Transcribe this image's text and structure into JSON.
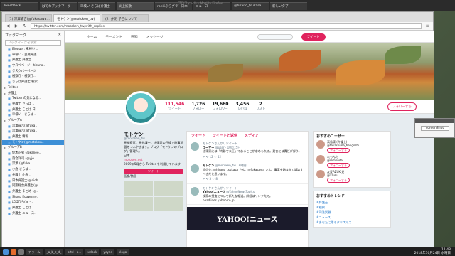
{
  "os_tabs": [
    "TweetDeck",
    "はてなブックマーク",
    "車検い さらば弁護士",
    "炎上拡散",
    "rankiぷらグラ - 日本",
    "ニュース",
    "@hirano_tsukasa",
    "新しいタブ"
  ],
  "window_title": "プロフィール - Mozilla Firefox",
  "browser_tabs": [
    "(1) 深澤諭吉(@fukasawa…",
    "モトケン(@motoken_tw)",
    "(2) 弁明 予告について"
  ],
  "url": "https://twitter.com/motoken_tw/with_replies",
  "sidebar": {
    "title": "ブックマーク",
    "search_placeholder": "ブックマークを検索",
    "items": [
      {
        "label": "Blogger: 車検い ..",
        "folder": false,
        "selected": false
      },
      {
        "label": "車検い - 良識弁護..",
        "folder": false,
        "selected": false
      },
      {
        "label": "弁護士 弁護士..",
        "folder": false,
        "selected": false
      },
      {
        "label": "ウスベベージ - hirano..",
        "folder": false,
        "selected": false
      },
      {
        "label": "タスクバーページ",
        "folder": false,
        "selected": false
      },
      {
        "label": "検察庁 - 検察庁..",
        "folder": false,
        "selected": false
      },
      {
        "label": "さらば弁護士 検索..",
        "folder": false,
        "selected": false
      },
      {
        "label": "Twitter",
        "folder": true,
        "selected": false
      },
      {
        "label": "弁護士",
        "folder": true,
        "selected": false
      },
      {
        "label": "Twitter の気になる..",
        "folder": false,
        "selected": false
      },
      {
        "label": "弁護士 さらば ..",
        "folder": false,
        "selected": false
      },
      {
        "label": "弁護士 ことば 日..",
        "folder": false,
        "selected": false
      },
      {
        "label": "車検い - さらば ..",
        "folder": false,
        "selected": false
      },
      {
        "label": "グループA",
        "folder": true,
        "selected": false
      },
      {
        "label": "深澤諭吉(@fuka..",
        "folder": false,
        "selected": false
      },
      {
        "label": "深澤諭吉(@fuka..",
        "folder": false,
        "selected": false
      },
      {
        "label": "弁護士 情報 ..",
        "folder": false,
        "selected": false
      },
      {
        "label": "モトケン(@motoken..",
        "folder": false,
        "selected": true
      },
      {
        "label": "グループB",
        "folder": true,
        "selected": false
      },
      {
        "label": "佐木正男 (@kanee..",
        "folder": false,
        "selected": false
      },
      {
        "label": "落合洋司 (@yjo..",
        "folder": false,
        "selected": false
      },
      {
        "label": "深澤 (@fuka..",
        "folder": false,
        "selected": false
      },
      {
        "label": "小倉 さらば ..",
        "folder": false,
        "selected": false
      },
      {
        "label": "弁護士 小倉 ..",
        "folder": false,
        "selected": false
      },
      {
        "label": "日本弁護士(@nich..",
        "folder": false,
        "selected": false
      },
      {
        "label": "同期総合弁護士(@..",
        "folder": false,
        "selected": false
      },
      {
        "label": "弁護士 まとめ (@..",
        "folder": false,
        "selected": false
      },
      {
        "label": "Shoko Egawa(@..",
        "folder": false,
        "selected": false
      },
      {
        "label": "ぼぼひろ(@ - ..",
        "folder": false,
        "selected": false
      },
      {
        "label": "弁護士 ことば..",
        "folder": false,
        "selected": false
      },
      {
        "label": "弁護士 ニュース..",
        "folder": false,
        "selected": false
      }
    ]
  },
  "twitter": {
    "nav": [
      "ホーム",
      "モーメント",
      "通知",
      "メッセージ"
    ],
    "tweet_button": "ツイート",
    "stats": [
      {
        "label": "ツイート",
        "value": "111,546",
        "active": true
      },
      {
        "label": "フォロー",
        "value": "1,726",
        "active": false
      },
      {
        "label": "フォロワー",
        "value": "19,660",
        "active": false
      },
      {
        "label": "いいね",
        "value": "3,456",
        "active": false
      },
      {
        "label": "リスト",
        "value": "2",
        "active": false
      }
    ],
    "follow_button": "フォローする",
    "profile": {
      "name": "モトケン",
      "handle": "@motoken_tw",
      "bio": "元検察官。元弁護士。法律家の目線で時事問題をつぶやきます。ブログ「モトケンのブログ」管理人。",
      "location": "日本",
      "link": "motoken.net",
      "joined": "2009年5月から Twitter を利用しています",
      "tweet_button": "ツイート",
      "media_label": "画像/動画"
    },
    "timeline_tabs": [
      "ツイート",
      "ツイートと返信",
      "メディア"
    ],
    "tweets": [
      {
        "retweet_note": "モトケンさんがリツイート",
        "name": "ユーザー",
        "handle": "@user · 10月15日",
        "text": "法律家には「冷静で公正」であることが求められる。発言には責任が伴う。",
        "actions": "↩  ⟲ 12  ♡ 42"
      },
      {
        "retweet_note": "",
        "name": "モトケン",
        "handle": "@motoken_tw · 8時間",
        "text": "返信先: @hirano_tsukasa さん、@fukasawa さん。事実を踏まえて議論すべきだと思います。",
        "actions": "↩  ⟲ 3  ♡ 8"
      },
      {
        "retweet_note": "モトケンさんがリツイート",
        "name": "Yahoo!ニュース",
        "handle": "@YahooNewsTopics",
        "text": "検察の捜査について新たな報道。詳細はリンク先で。 headlines.yahoo.co.jp",
        "actions": ""
      }
    ],
    "yahoo_card": "YAHOO!ニュース",
    "who_to_follow": {
      "title": "おすすめユーザー",
      "users": [
        {
          "name": "高島康 (弁護士)",
          "handle": "@takashima_bengoshi",
          "button": "フォローする"
        },
        {
          "name": "れもんだ",
          "handle": "@remonda",
          "button": "フォローする"
        },
        {
          "name": "友愛AZUKI党",
          "handle": "@azuki",
          "button": "フォローする"
        }
      ]
    },
    "trends": {
      "title": "おすすめトレンド",
      "items": [
        "#弁護士",
        "#検察",
        "#司法試験",
        "#ニュース",
        "#あなたに贈るクリスマス"
      ]
    }
  },
  "widget": {
    "button": "screenShot"
  },
  "taskbar": {
    "items": [
      "アラーム",
      "_a_b_c_d_",
      "srtd - b...",
      "xclock",
      "yeyes",
      "xlogo"
    ],
    "clock_time": "11:48",
    "clock_date": "2018年10月24日 水曜日"
  }
}
